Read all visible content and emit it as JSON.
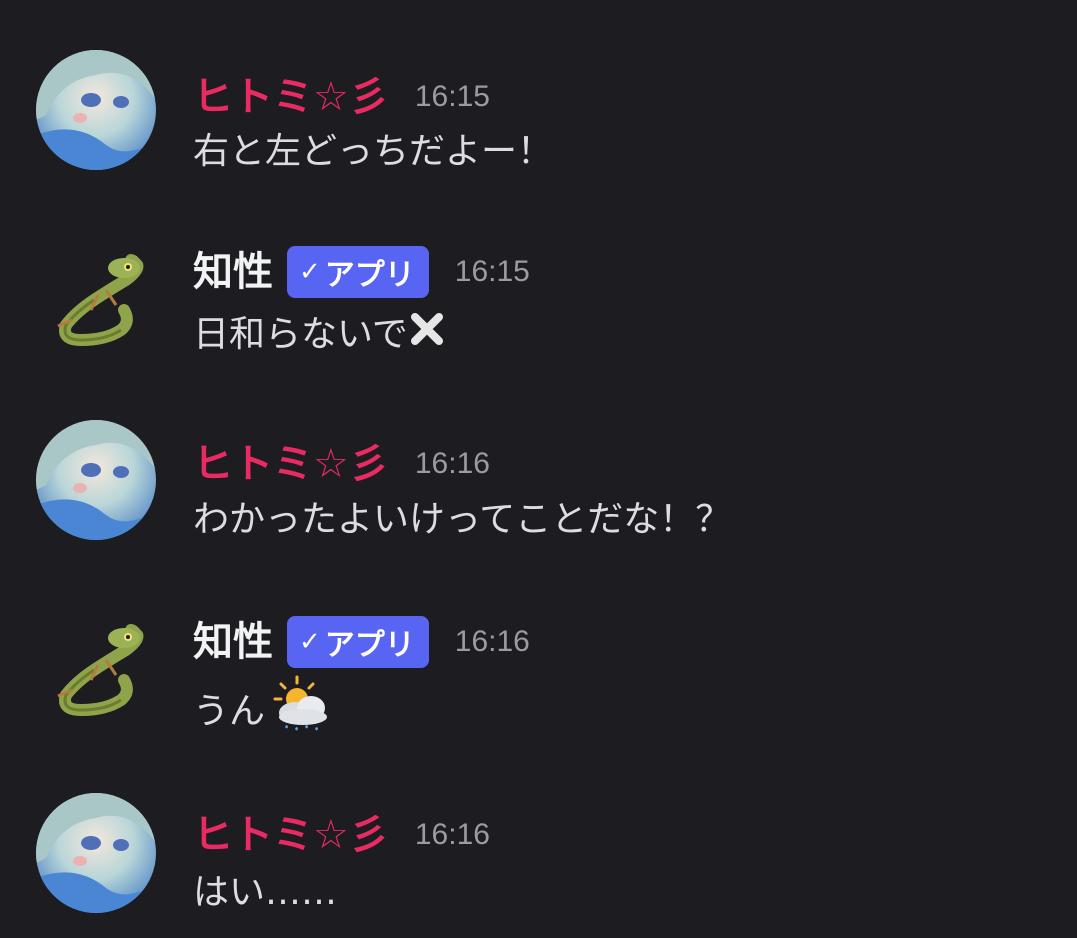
{
  "messages": [
    {
      "author": "ヒトミ☆彡",
      "time": "16:15",
      "text": "右と左どっちだよー！",
      "emoji": ""
    },
    {
      "author": "知性",
      "badge": "アプリ",
      "time": "16:15",
      "text": "日和らないで",
      "emoji": "cross-mark-icon"
    },
    {
      "author": "ヒトミ☆彡",
      "time": "16:16",
      "text": "わかったよいけってことだな！？",
      "emoji": ""
    },
    {
      "author": "知性",
      "badge": "アプリ",
      "time": "16:16",
      "text": "うん",
      "emoji": "sun-behind-rain-cloud-icon"
    },
    {
      "author": "ヒトミ☆彡",
      "time": "16:16",
      "text": "はい……",
      "emoji": ""
    }
  ],
  "colors": {
    "background": "#1c1c21",
    "hitomi_name": "#ea2a63",
    "bot_name": "#f2f3f5",
    "app_badge": "#5865f2",
    "timestamp": "#9a9ba3",
    "message_text": "#dcdde1"
  }
}
